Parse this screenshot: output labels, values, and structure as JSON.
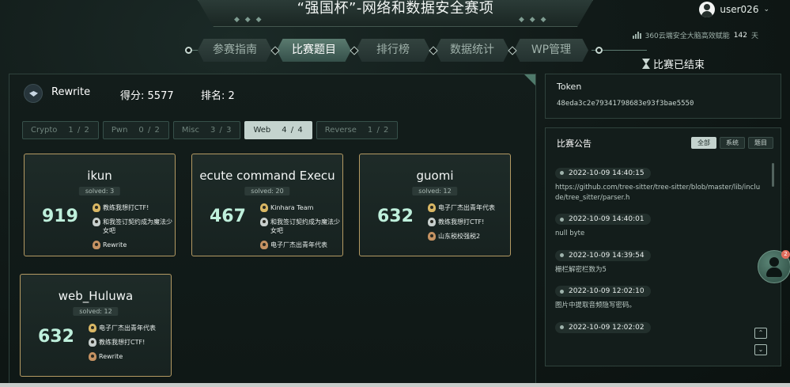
{
  "header": {
    "title": "“强国杯”-网络和数据安全赛项",
    "deco_left": "◆ ◆ ◆",
    "deco_right": "◆ ◆ ◆",
    "username": "user026",
    "user_caret": "⌄",
    "server_prefix": "360云端安全大脑高效赋能",
    "server_days": "142",
    "server_suffix": "天",
    "status_text": "比赛已结束"
  },
  "nav": {
    "tabs": [
      {
        "label": "参赛指南"
      },
      {
        "label": "比赛题目"
      },
      {
        "label": "排行榜"
      },
      {
        "label": "数据统计"
      },
      {
        "label": "WP管理"
      }
    ],
    "active_index": 1
  },
  "team": {
    "name": "Rewrite",
    "score_label": "得分:",
    "score": "5577",
    "rank_label": "排名:",
    "rank": "2"
  },
  "filters": [
    {
      "label": "Crypto",
      "count": "1 / 2",
      "active": false
    },
    {
      "label": "Pwn",
      "count": "0 / 2",
      "active": false
    },
    {
      "label": "Misc",
      "count": "3 / 3",
      "active": false
    },
    {
      "label": "Web",
      "count": "4 / 4",
      "active": true
    },
    {
      "label": "Reverse",
      "count": "1 / 2",
      "active": false
    }
  ],
  "challenges": [
    {
      "title": "ikun",
      "solved": "solved: 3",
      "score": "919",
      "solvers": [
        {
          "medal": "gold",
          "name": "教练我想打CTF!"
        },
        {
          "medal": "silver",
          "name": "和我签订契约成为魔法少女吧"
        },
        {
          "medal": "bronze",
          "name": "Rewrite"
        }
      ]
    },
    {
      "title": "ecute command Execu",
      "solved": "solved: 20",
      "score": "467",
      "solvers": [
        {
          "medal": "gold",
          "name": "Kinhara Team"
        },
        {
          "medal": "silver",
          "name": "和我签订契约成为魔法少女吧"
        },
        {
          "medal": "bronze",
          "name": "电子厂杰出青年代表"
        }
      ]
    },
    {
      "title": "guomi",
      "solved": "solved: 12",
      "score": "632",
      "solvers": [
        {
          "medal": "gold",
          "name": "电子厂杰出青年代表"
        },
        {
          "medal": "silver",
          "name": "教练我想打CTF!"
        },
        {
          "medal": "bronze",
          "name": "山东税校强税2"
        }
      ]
    },
    {
      "title": "web_Huluwa",
      "solved": "solved: 12",
      "score": "632",
      "solvers": [
        {
          "medal": "gold",
          "name": "电子厂杰出青年代表"
        },
        {
          "medal": "silver",
          "name": "教练我想打CTF!"
        },
        {
          "medal": "bronze",
          "name": "Rewrite"
        }
      ]
    }
  ],
  "token": {
    "label": "Token",
    "value": "48eda3c2e79341798683e93f3bae5550"
  },
  "notices": {
    "title": "比赛公告",
    "tabs": [
      "全部",
      "系统",
      "题目"
    ],
    "active_tab": 0,
    "items": [
      {
        "time": "2022-10-09 14:40:15",
        "text": "https://github.com/tree-sitter/tree-sitter/blob/master/lib/include/tree_sitter/parser.h"
      },
      {
        "time": "2022-10-09 14:40:01",
        "text": "null byte"
      },
      {
        "time": "2022-10-09 14:39:54",
        "text": "栅栏解密栏数为5"
      },
      {
        "time": "2022-10-09 12:02:10",
        "text": "图片中提取音频隐写密码。"
      },
      {
        "time": "2022-10-09 12:02:02",
        "text": ""
      }
    ],
    "scroll_up": "⌃",
    "scroll_down": "⌄"
  },
  "float_badge": "2",
  "colors": {
    "background": "#0f1715",
    "card_border": "#b49a63",
    "score_text": "#bff0dc",
    "active_tab": "#c4d3ce"
  }
}
